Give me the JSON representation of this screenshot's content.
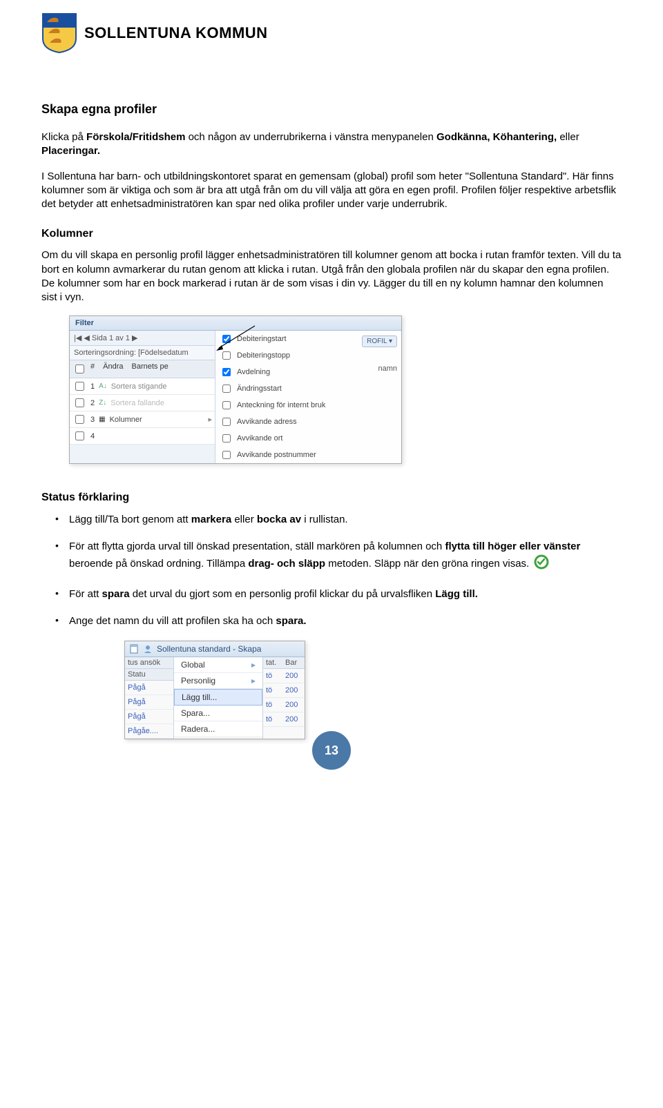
{
  "header": {
    "org": "SOLLENTUNA KOMMUN"
  },
  "title": "Skapa egna profiler",
  "para1_a": "Klicka på ",
  "para1_b": "Förskola/Fritidshem",
  "para1_c": " och någon av underrubrikerna i vänstra menypanelen ",
  "para1_d": "Godkänna, Köhantering,",
  "para1_e": " eller ",
  "para1_f": "Placeringar.",
  "para2": "I Sollentuna har barn- och utbildningskontoret sparat en gemensam (global) profil som heter \"Sollentuna Standard\". Här finns kolumner som är viktiga och som är bra att utgå från om du vill välja att göra en egen profil. Profilen följer respektive arbetsflik det betyder att enhetsadministratören kan spar ned olika profiler under varje underrubrik.",
  "sub1": "Kolumner",
  "para3": "Om du vill skapa en personlig profil lägger enhetsadministratören till kolumner genom att bocka i rutan framför texten. Vill du ta bort en kolumn avmarkerar du rutan genom att klicka i rutan. Utgå från den globala profilen när du skapar den egna profilen. De kolumner som har en bock markerad i rutan är de som visas i din vy. Lägger du till en ny kolumn hamnar den kolumnen sist i vyn.",
  "shot1": {
    "filter": "Filter",
    "pager": "|◀  ◀    Sida    1    av 1    ▶",
    "sort": "Sorteringsordning: [Födelsedatum",
    "head_num": "#",
    "head_andra": "Ändra",
    "head_barnet": "Barnets pe",
    "menu_sort_asc": "Sortera stigande",
    "menu_sort_desc": "Sortera fallande",
    "menu_cols": "Kolumner",
    "col1": "Debiteringstart",
    "col2": "Debiteringstopp",
    "col3": "Avdelning",
    "col4": "Ändringsstart",
    "col5": "Anteckning för internt bruk",
    "col6": "Avvikande adress",
    "col7": "Avvikande ort",
    "col8": "Avvikande postnummer",
    "profile_pill": "ROFIL ▾",
    "namn": "namn"
  },
  "sub2": "Status förklaring",
  "bul1_a": "Lägg till/Ta bort genom att ",
  "bul1_b": "markera",
  "bul1_c": " eller ",
  "bul1_d": "bocka av",
  "bul1_e": " i rullistan.",
  "bul2_a": "För att flytta gjorda urval till önskad presentation, ställ markören på kolumnen och ",
  "bul2_b": "flytta till höger eller vänster",
  "bul2_c": " beroende på önskad ordning. Tillämpa ",
  "bul2_d": "drag- och släpp",
  "bul2_e": " metoden. Släpp när den gröna ringen visas. ",
  "bul3_a": "För att ",
  "bul3_b": "spara",
  "bul3_c": " det urval du gjort som en personlig profil klickar du på urvalsfliken ",
  "bul3_d": "Lägg till.",
  "bul4_a": "Ange det namn du vill att profilen ska ha och ",
  "bul4_b": "spara.",
  "shot2": {
    "top": "Sollentuna standard - Skapa",
    "left_head": "tus ansök",
    "col_statu": "Statu",
    "col_tat": "tat.",
    "col_bar": "Bar",
    "val_paga": "Pågå",
    "val_pagae": "Pågåe....",
    "val_to": "tö",
    "val_20": "200",
    "m_global": "Global",
    "m_personlig": "Personlig",
    "m_lagg": "Lägg till...",
    "m_spara": "Spara...",
    "m_radera": "Radera..."
  },
  "page_number": "13"
}
